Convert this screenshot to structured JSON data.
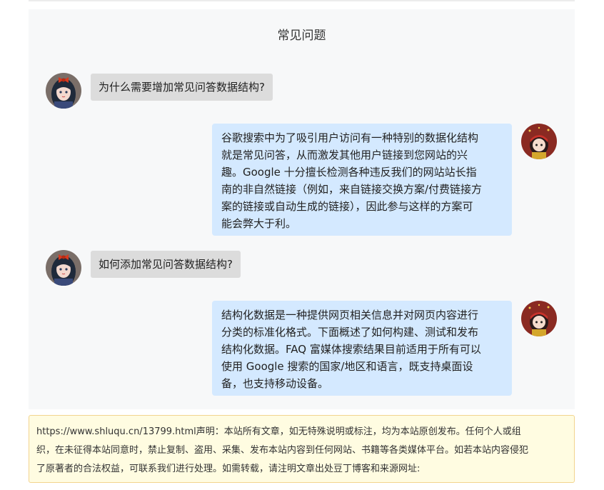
{
  "faq": {
    "title": "常见问题",
    "items": [
      {
        "question": "为什么需要增加常见问答数据结构?",
        "answer_lines": [
          "谷歌搜索中为了吸引用户访问有一种特别的数据化结构",
          "就是常见问答，从而激发其他用户链接到您网站的兴",
          "趣。Google 十分擅长检测各种违反我们的网站站长指",
          "南的非自然链接（例如，来自链接交换方案/付费链接方",
          "案的链接或自动生成的链接），因此参与这样的方案可",
          "能会弊大于利。"
        ]
      },
      {
        "question": "如何添加常见问答数据结构?",
        "answer_lines": [
          "结构化数据是一种提供网页相关信息并对网页内容进行",
          "分类的标准化格式。下面概述了如何构建、测试和发布",
          "结构化数据。FAQ 富媒体搜索结果目前适用于所有可以",
          "使用 Google 搜索的国家/地区和语言，既支持桌面设",
          "备，也支持移动设备。"
        ]
      }
    ]
  },
  "notice": {
    "lines": [
      "https://www.shluqu.cn/13799.html声明：本站所有文章，如无特殊说明或标注，均为本站原创发布。任何个人或组",
      "织，在未征得本站同意时，禁止复制、盗用、采集、发布本站内容到任何网站、书籍等各类媒体平台。如若本站内容侵犯",
      "了原著者的合法权益，可联系我们进行处理。如需转载，请注明文章出处豆丁博客和来源网址:"
    ]
  },
  "colors": {
    "panel_bg": "#f7f8f9",
    "question_bubble": "#dcdcdc",
    "answer_bubble": "#d4e9ff",
    "notice_bg": "#fffce1",
    "notice_border": "#f2d48e"
  },
  "icons": {
    "asker_avatar": "girl-with-red-bow-avatar",
    "answerer_avatar": "girl-red-hood-avatar"
  }
}
